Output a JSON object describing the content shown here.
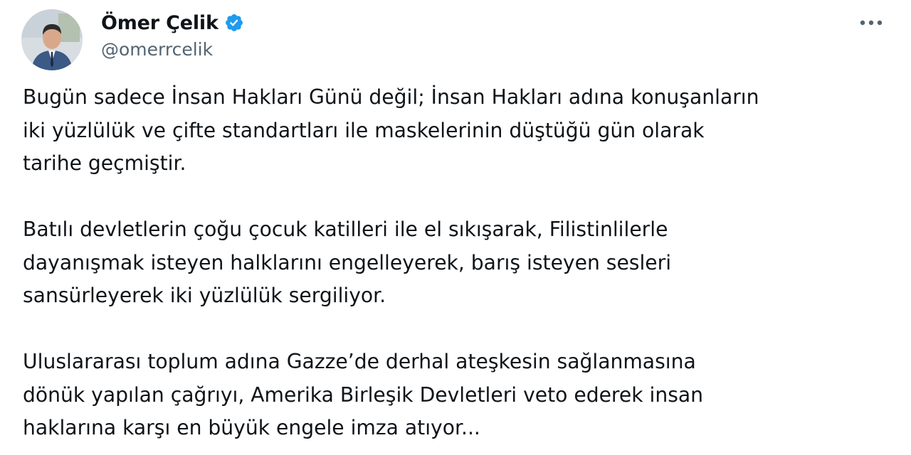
{
  "author": {
    "display_name": "Ömer Çelik",
    "handle": "@omerrcelik",
    "verified": true,
    "verified_color": "#1d9bf0"
  },
  "menu": {
    "more_icon": "more-horizontal-icon"
  },
  "tweet": {
    "paragraphs": [
      {
        "lines": [
          "Bugün sadece İnsan Hakları Günü değil; İnsan Hakları adına konuşanların",
          "iki yüzlülük ve çifte standartları ile maskelerinin düştüğü gün olarak",
          "tarihe geçmiştir."
        ]
      },
      {
        "lines": [
          "Batılı devletlerin çoğu çocuk katilleri ile el sıkışarak, Filistinlilerle",
          "dayanışmak isteyen halklarını engelleyerek, barış isteyen sesleri",
          "sansürleyerek iki yüzlülük sergiliyor."
        ]
      },
      {
        "lines": [
          "Uluslararası toplum adına Gazze’de derhal ateşkesin sağlanmasına",
          "dönük yapılan çağrıyı, Amerika Birleşik Devletleri veto ederek insan",
          "haklarına karşı en büyük engele imza atıyor..."
        ]
      }
    ]
  }
}
